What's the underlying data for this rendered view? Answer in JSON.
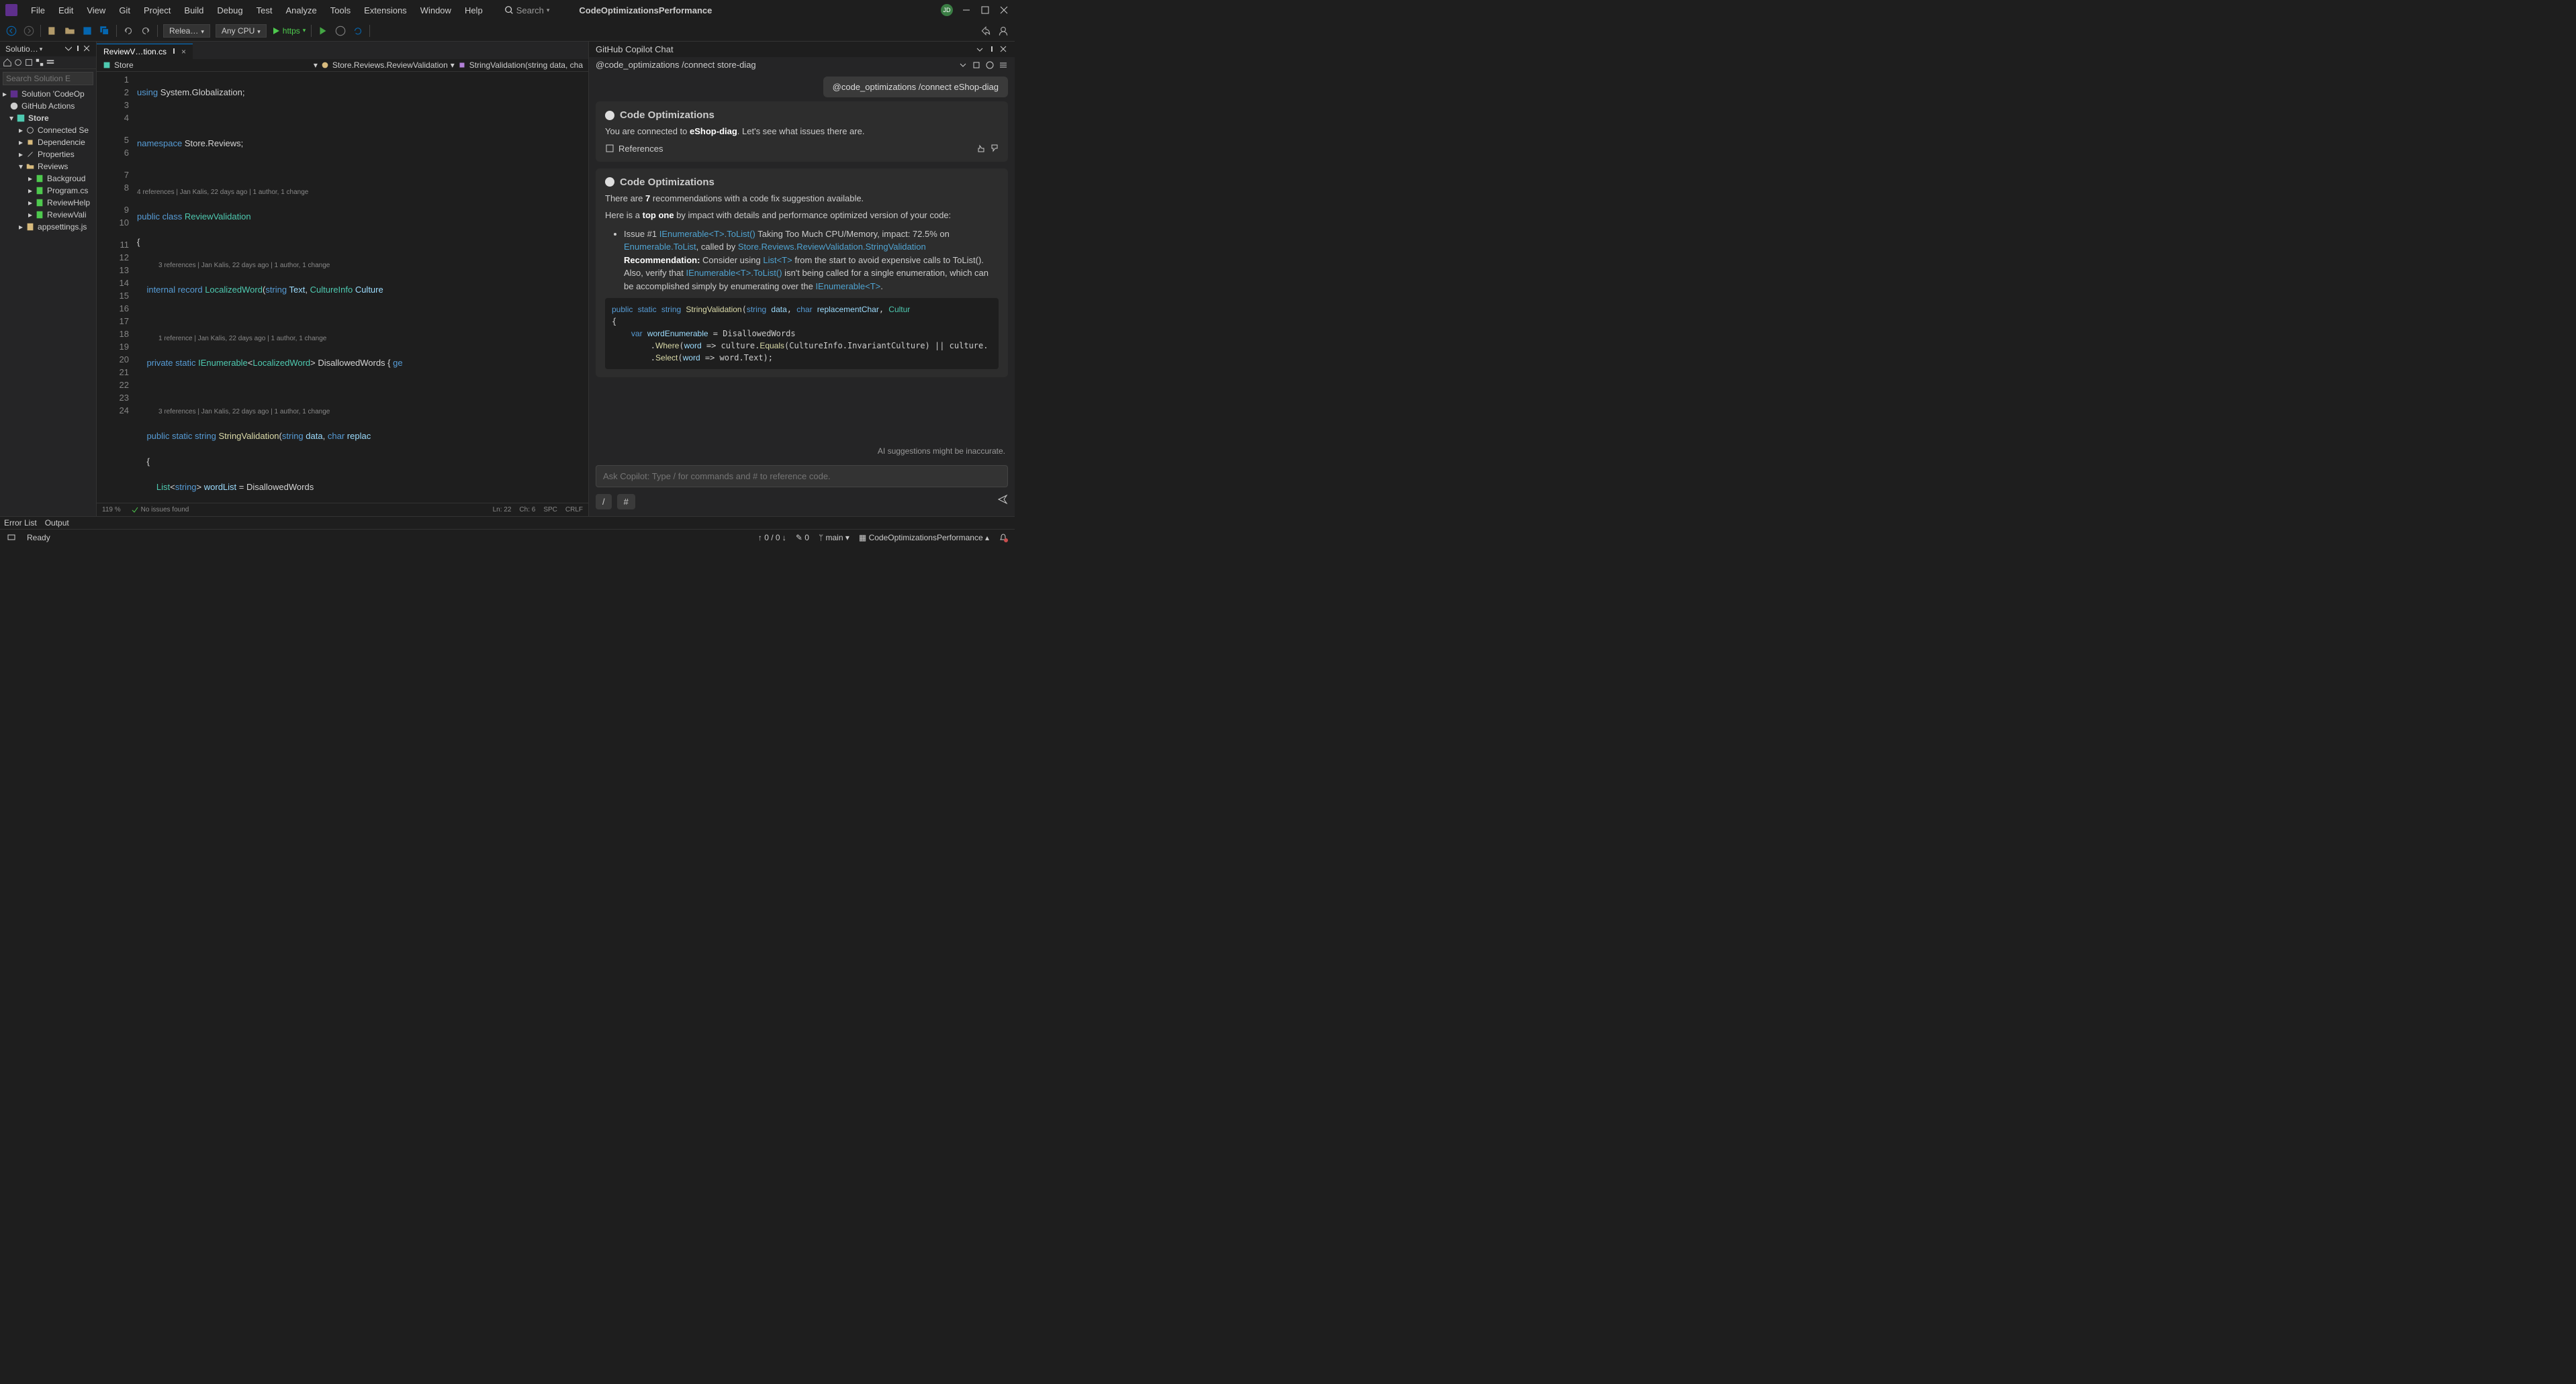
{
  "app": {
    "title": "CodeOptimizationsPerformance",
    "search_placeholder": "Search"
  },
  "menu": [
    "File",
    "Edit",
    "View",
    "Git",
    "Project",
    "Build",
    "Debug",
    "Test",
    "Analyze",
    "Tools",
    "Extensions",
    "Window",
    "Help"
  ],
  "avatar": "JD",
  "toolbar": {
    "config": "Relea…",
    "platform": "Any CPU",
    "run": "https"
  },
  "solExp": {
    "title": "Solutio…",
    "search_placeholder": "Search Solution E",
    "items": [
      {
        "label": "Solution 'CodeOp",
        "icon": "sln",
        "indent": 0
      },
      {
        "label": "GitHub Actions",
        "icon": "gh",
        "indent": 1
      },
      {
        "label": "Store",
        "icon": "proj",
        "indent": 1,
        "bold": true
      },
      {
        "label": "Connected Se",
        "icon": "conn",
        "indent": 2
      },
      {
        "label": "Dependencie",
        "icon": "dep",
        "indent": 2
      },
      {
        "label": "Properties",
        "icon": "prop",
        "indent": 2
      },
      {
        "label": "Reviews",
        "icon": "folder",
        "indent": 2
      },
      {
        "label": "Backgroud",
        "icon": "cs",
        "indent": 3
      },
      {
        "label": "Program.cs",
        "icon": "cs",
        "indent": 3
      },
      {
        "label": "ReviewHelp",
        "icon": "cs",
        "indent": 3
      },
      {
        "label": "ReviewVali",
        "icon": "cs",
        "indent": 3
      },
      {
        "label": "appsettings.js",
        "icon": "json",
        "indent": 2
      }
    ]
  },
  "tab": {
    "label": "ReviewV…tion.cs"
  },
  "breadcrumb": {
    "b1": "Store",
    "b2": "Store.Reviews.ReviewValidation",
    "b3": "StringValidation(string data, cha"
  },
  "code": {
    "lens1": "4 references | Jan Kalis, 22 days ago | 1 author, 1 change",
    "lens2": "3 references | Jan Kalis, 22 days ago | 1 author, 1 change",
    "lens3": "1 reference | Jan Kalis, 22 days ago | 1 author, 1 change",
    "lens4": "3 references | Jan Kalis, 22 days ago | 1 author, 1 change"
  },
  "editorStatus": {
    "zoom": "119 %",
    "issues": "No issues found",
    "ln": "Ln: 22",
    "ch": "Ch: 6",
    "spc": "SPC",
    "crlf": "CRLF"
  },
  "copilot": {
    "header": "GitHub Copilot Chat",
    "command": "@code_optimizations /connect store-diag",
    "pill": "@code_optimizations /connect eShop-diag",
    "msg1_title": "Code Optimizations",
    "msg1_pre": "You are connected to ",
    "msg1_bold": "eShop-diag",
    "msg1_post": ". Let's see what issues there are.",
    "refs": "References",
    "msg2_title": "Code Optimizations",
    "msg2_l1_a": "There are ",
    "msg2_l1_b": "7",
    "msg2_l1_c": " recommendations with a code fix suggestion available.",
    "msg2_l2_a": "Here is a ",
    "msg2_l2_b": "top one",
    "msg2_l2_c": " by impact with details and performance optimized version of your code:",
    "issue_a": "Issue #1 ",
    "issue_link1": "IEnumerable<T>.ToList()",
    "issue_b": " Taking Too Much CPU/Memory, impact: 72.5% on ",
    "issue_link2": "Enumerable.ToList",
    "issue_c": ", called by ",
    "issue_link3": "Store.Reviews.ReviewValidation.StringValidation",
    "rec_label": "Recommendation:",
    "rec_a": " Consider using ",
    "rec_link1": "List<T>",
    "rec_b": " from the start to avoid expensive calls to ToList(). Also, verify that ",
    "rec_link2": "IEnumerable<T>.ToList()",
    "rec_c": " isn't being called for a single enumeration, which can be accomplished simply by enumerating over the ",
    "rec_link3": "IEnumerable<T>",
    "rec_d": ".",
    "disclaimer": "AI suggestions might be inaccurate.",
    "input_placeholder": "Ask Copilot: Type / for commands and # to reference code.",
    "q1": "/",
    "q2": "#"
  },
  "bottomTabs": [
    "Error List",
    "Output"
  ],
  "status": {
    "ready": "Ready",
    "upDown": "↑ 0 / 0 ↓",
    "pen": "✎ 0",
    "branch": "main",
    "proj": "CodeOptimizationsPerformance"
  }
}
